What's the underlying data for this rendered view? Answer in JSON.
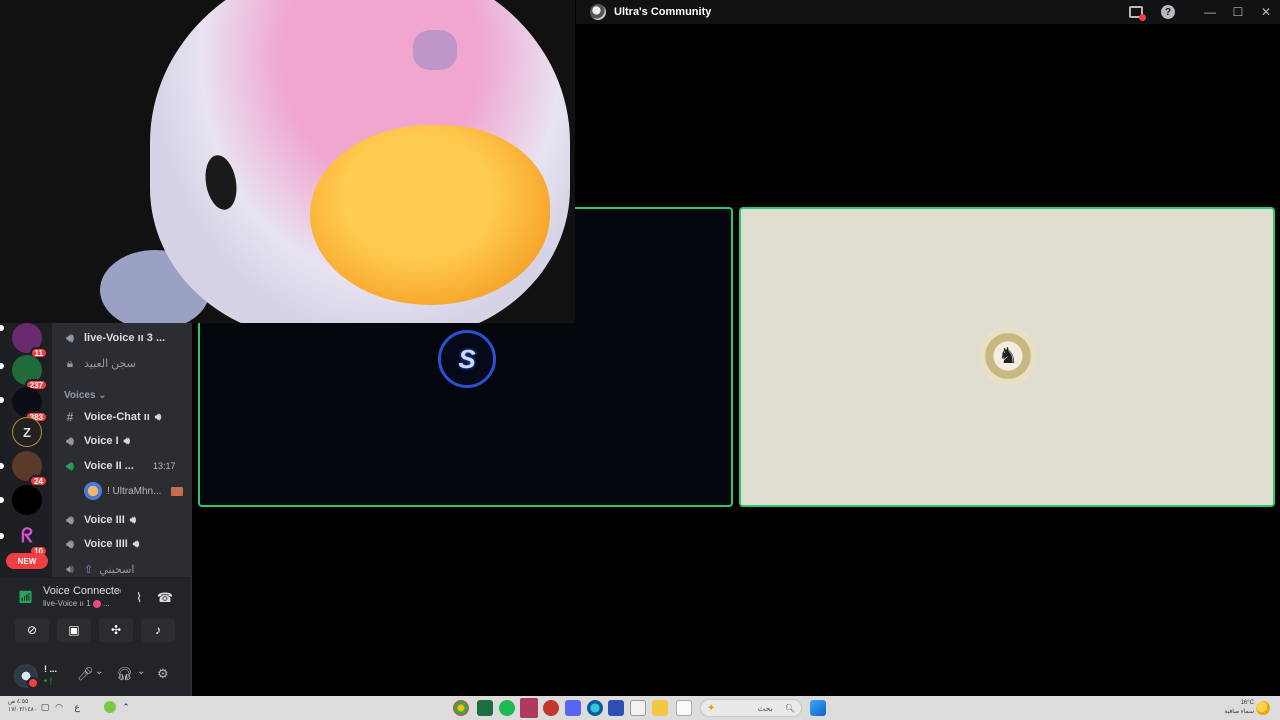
{
  "window": {
    "title": "Ultra's Community",
    "minimize": "—",
    "maximize": "☐",
    "close": "✕",
    "help": "?"
  },
  "stage": {
    "left_avatar_letter": "S",
    "right_avatar_glyph": "♞"
  },
  "sidebar": {
    "guild_badges": [
      "11",
      "237",
      "383",
      "24",
      "10"
    ],
    "new_label": "NEW",
    "channels": {
      "live_voice": "live-Voice ıı 3 ...",
      "locked": "سجن العبيد",
      "section": "Voices ⌄",
      "voice_chat": "Voice-Chat ıı",
      "voice_1": "Voice I",
      "voice_2": "Voice II ...",
      "voice_2_time": "13:17",
      "member_name": "! UltraMhn...",
      "voice_3": "Voice III",
      "voice_4": "Voice IIII",
      "last": "اسحبني"
    }
  },
  "voice_panel": {
    "status": "Voice Connected",
    "channel": "live-Voice ıı 1",
    "channel_suffix": "...",
    "user_name": "! ...",
    "user_status": "• !"
  },
  "taskbar": {
    "time": "٤:٥٥ ص",
    "date": "١٧/٠٢/١٤٨٠",
    "lang": "ع",
    "search_placeholder": "بحث",
    "weather_temp": "16°C",
    "weather_desc": "سماء صافية"
  },
  "colors": {
    "speaking_border": "#2dc770",
    "notification_red": "#f23f43",
    "avatar_ring_blue": "#2b50d4"
  }
}
